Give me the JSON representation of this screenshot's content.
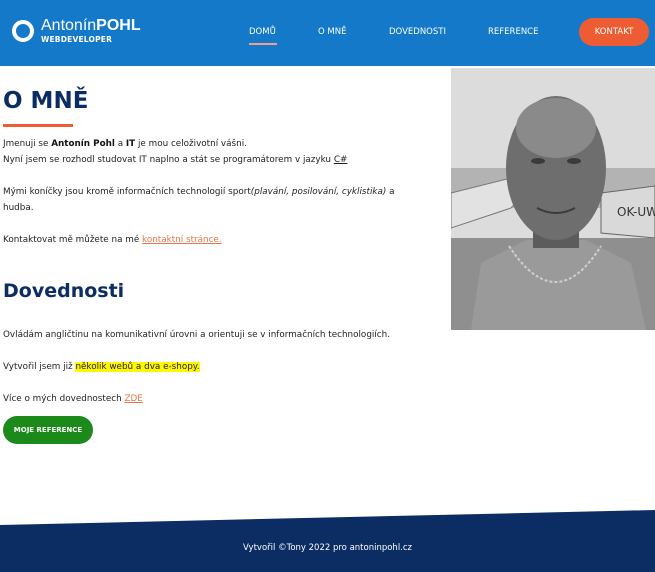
{
  "brand": {
    "first": "Antonín",
    "last": "POHL",
    "subtitle": "WEBDEVELOPER"
  },
  "nav": {
    "items": [
      "DOMŮ",
      "O MNĚ",
      "DOVEDNOSTI",
      "REFERENCE"
    ],
    "contact_label": "KONTAKT",
    "active": "DOMŮ"
  },
  "about": {
    "heading": "O MNĚ",
    "p1_a": "Jmenuji se ",
    "p1_name": "Antonín Pohl",
    "p1_b": " a ",
    "p1_it": "IT",
    "p1_c": " je mou celoživotní vášni.",
    "p2_a": "Nyní jsem se rozhodl studovat IT naplno a stát se programátorem v jazyku ",
    "p2_link": "C#",
    "p3_a": "Mými koníčky jsou kromě informačních technologií sport",
    "p3_italic": "(plavání, posilování, cyklistika)",
    "p3_b": " a",
    "p3_line2": "hudba.",
    "p4_a": "Kontaktovat mě můžete na mé ",
    "p4_link": "kontaktní stránce."
  },
  "skills": {
    "heading": "Dovednosti",
    "p1": "Ovládám angličtinu na komunikativní úrovni a orientuji se v informačních technologiích.",
    "p2_a": "Vytvořil jsem již ",
    "p2_highlight": "několik webů a dva e-shopy.",
    "p3_a": "Více o mých dovednostech ",
    "p3_link": "ZDE",
    "button_label": "MOJE REFERENCE"
  },
  "footer": {
    "text": "Vytvořil ©Tony 2022 pro antoninpohl.cz"
  },
  "colors": {
    "header": "#1479c9",
    "accent": "#ee5c33",
    "heading": "#0b2d63",
    "footer": "#0b2d63",
    "button_green": "#1b8a1b",
    "highlight": "#fff700"
  }
}
